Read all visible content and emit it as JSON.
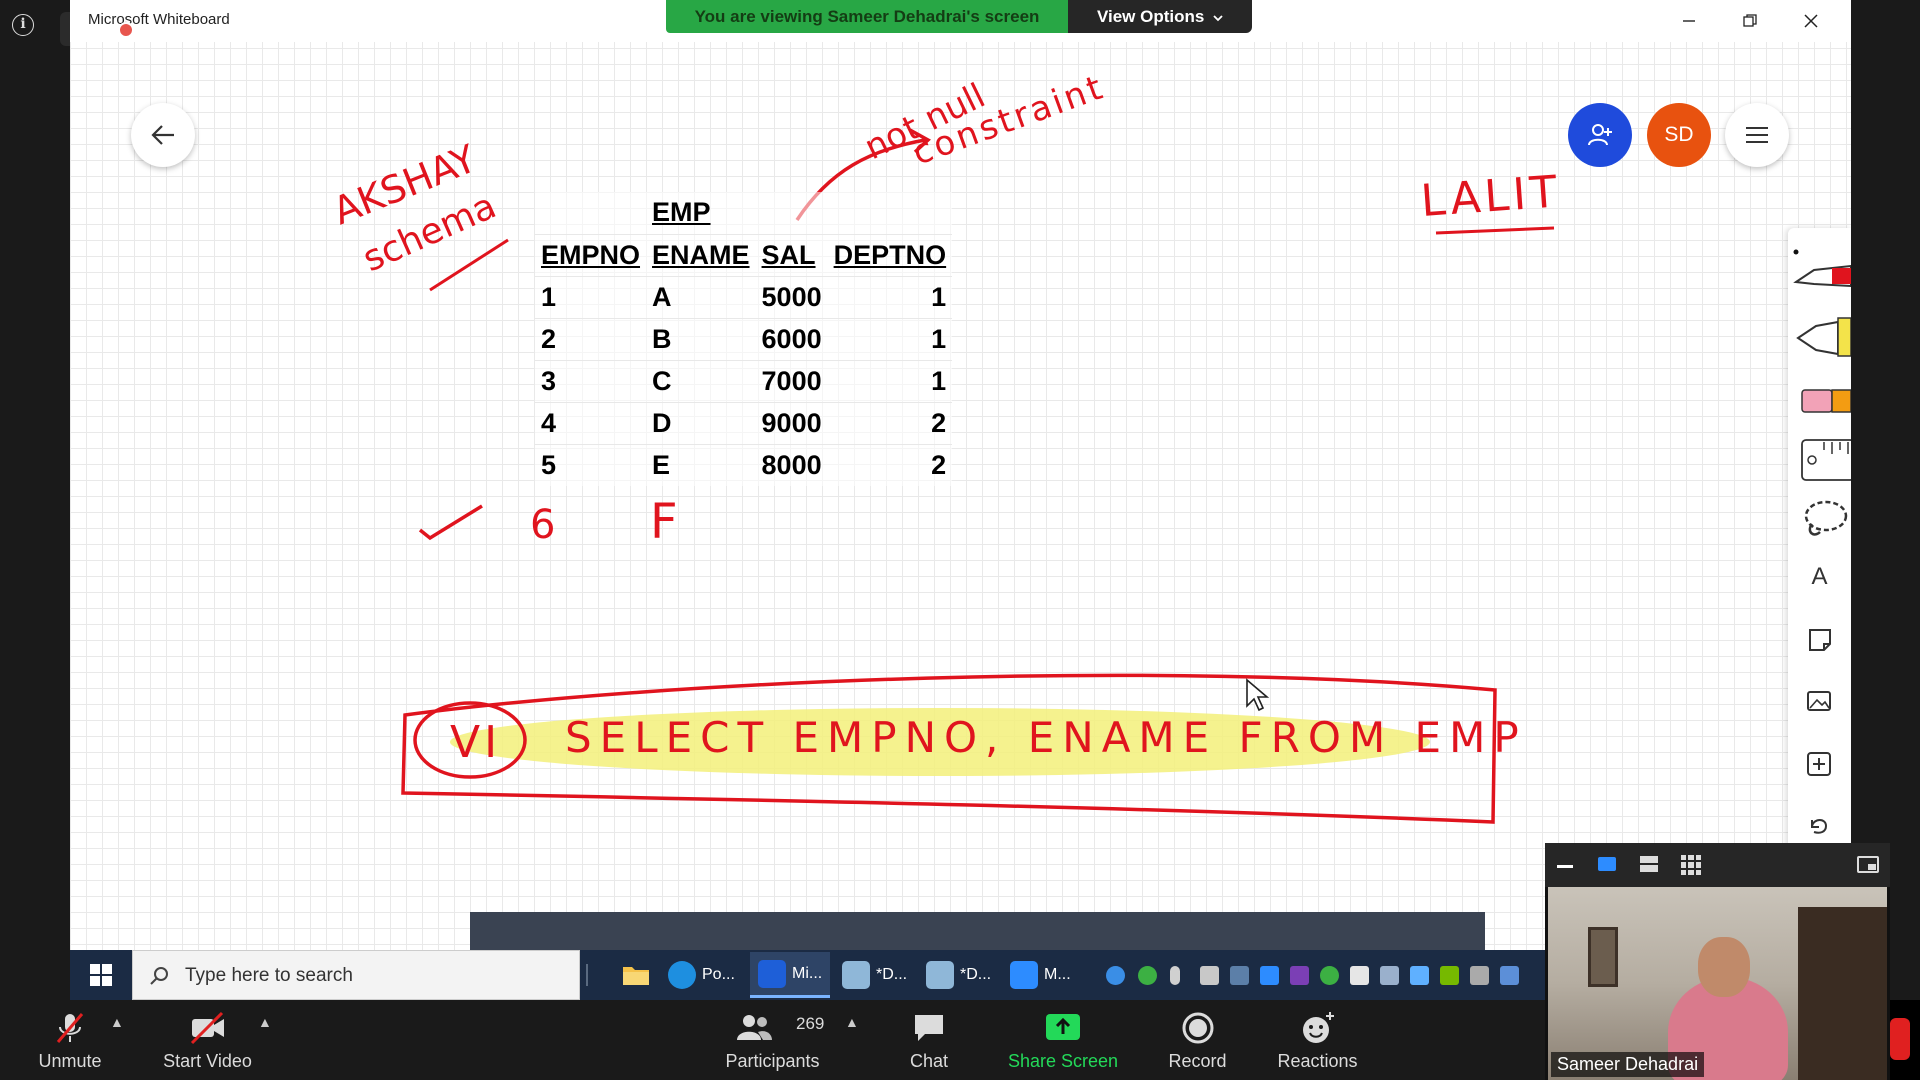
{
  "window": {
    "app_title": "Microsoft Whiteboard"
  },
  "share": {
    "banner_text": "You are viewing Sameer Dehadrai's screen",
    "view_options_label": "View Options"
  },
  "whiteboard": {
    "avatar_initials": "SD",
    "ink": {
      "schema_label_1": "AKSHAY",
      "schema_label_2": "schema",
      "constraint_label_1": "not null",
      "constraint_label_2": "constraint",
      "right_label": "LALIT",
      "new_row_id": "6",
      "new_row_name": "F",
      "query_prefix": "VI",
      "query": "SELECT EMPNO, ENAME FROM EMP"
    },
    "table": {
      "caption": "EMP",
      "headers": [
        "EMPNO",
        "ENAME",
        "SAL",
        "DEPTNO"
      ],
      "rows": [
        [
          "1",
          "A",
          "5000",
          "1"
        ],
        [
          "2",
          "B",
          "6000",
          "1"
        ],
        [
          "3",
          "C",
          "7000",
          "1"
        ],
        [
          "4",
          "D",
          "9000",
          "2"
        ],
        [
          "5",
          "E",
          "8000",
          "2"
        ]
      ]
    },
    "tools": [
      "pen-icon",
      "highlighter-icon",
      "eraser-icon",
      "ruler-icon",
      "lasso-icon",
      "text-icon",
      "note-icon",
      "image-icon",
      "insert-icon",
      "undo-icon"
    ],
    "tool_text_glyph": "A"
  },
  "taskbar": {
    "search_placeholder": "Type here to search",
    "apps": [
      {
        "name": "edge-app",
        "label": "Po...",
        "color": "#1e8fe0"
      },
      {
        "name": "whiteboard-app",
        "label": "Mi...",
        "color": "#1e5fd8"
      },
      {
        "name": "notepad-app-1",
        "label": "*D...",
        "color": "#8fb7d8"
      },
      {
        "name": "notepad-app-2",
        "label": "*D...",
        "color": "#8fb7d8"
      },
      {
        "name": "zoom-app",
        "label": "M...",
        "color": "#2d8cff"
      }
    ]
  },
  "zoom": {
    "unmute_label": "Unmute",
    "start_video_label": "Start Video",
    "participants_label": "Participants",
    "participants_count": "269",
    "chat_label": "Chat",
    "share_screen_label": "Share Screen",
    "record_label": "Record",
    "reactions_label": "Reactions",
    "speaker_name": "Sameer Dehadrai",
    "accent_green": "#28a745",
    "share_green": "#23d959"
  }
}
